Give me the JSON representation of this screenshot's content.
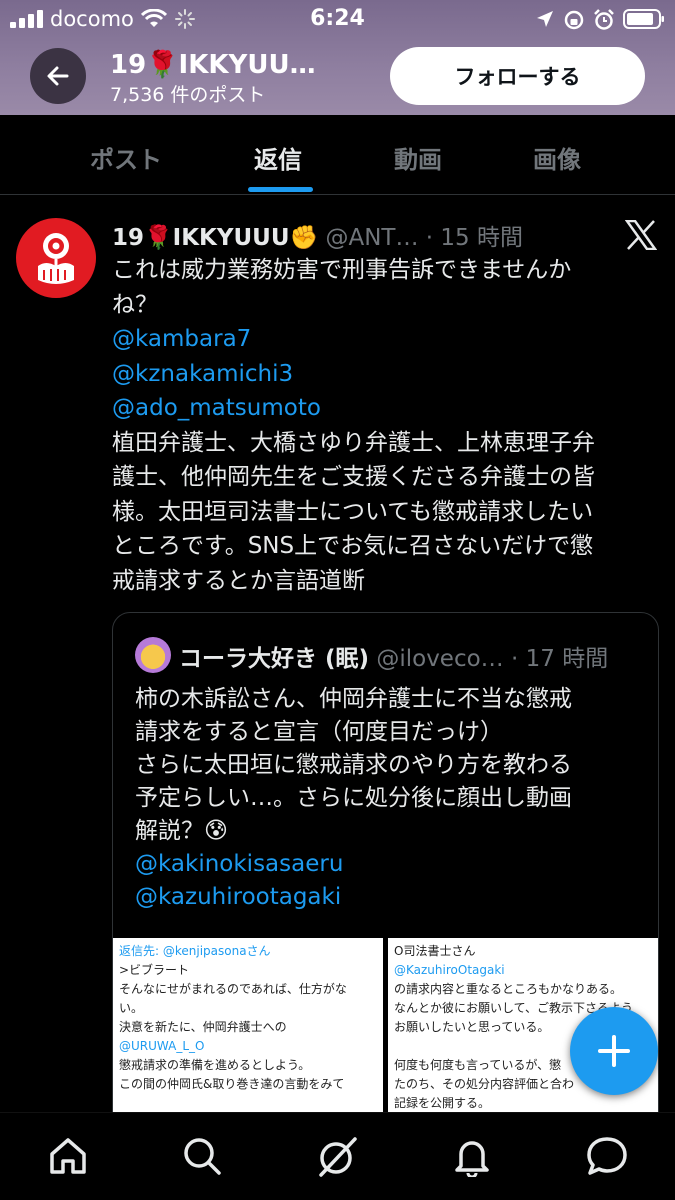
{
  "status_bar": {
    "carrier": "docomo",
    "time": "6:24"
  },
  "header": {
    "title": "19🌹IKKYUU…",
    "post_count": "7,536 件のポスト",
    "follow_label": "フォローする"
  },
  "tabs": [
    {
      "label": "ポスト",
      "active": false
    },
    {
      "label": "返信",
      "active": true
    },
    {
      "label": "動画",
      "active": false
    },
    {
      "label": "画像",
      "active": false
    }
  ],
  "tweet": {
    "display_name": "19🌹IKKYUUU✊",
    "handle": "@ANT…",
    "time": "· 15 時間",
    "text_lines": [
      "これは威力業務妨害で刑事告訴できませんか",
      "ね？"
    ],
    "mentions": [
      "@kambara7",
      "@kznakamichi3",
      "@ado_matsumoto"
    ],
    "body_lines": [
      "植田弁護士、大橋さゆり弁護士、上林恵理子弁",
      "護士、他仲岡先生をご支援くださる弁護士の皆",
      "様。太田垣司法書士についても懲戒請求したい",
      "ところです。SNS上でお気に召さないだけで懲",
      "戒請求するとか言語道断"
    ]
  },
  "quote": {
    "display_name": "コーラ大好き (眠)",
    "handle": "@iloveco…",
    "time": "· 17 時間",
    "lines": [
      "柿の木訴訟さん、仲岡弁護士に不当な懲戒",
      "請求をすると宣言（何度目だっけ）",
      "さらに太田垣に懲戒請求のやり方を教わる",
      "予定らしい…。さらに処分後に顔出し動画",
      "解説？😰"
    ],
    "mentions": [
      "@kakinokisasaeru",
      "@kazuhirootagaki"
    ],
    "image_left": {
      "reply_to": "返信先: @kenjipasonaさん",
      "lines": [
        ">ビブラート",
        "そんなにせがまれるのであれば、仕方がな",
        "い。",
        "決意を新たに、仲岡弁護士への",
        "@URUWA_L_O",
        "懲戒請求の準備を進めるとしよう。",
        "この間の仲岡氏&取り巻き達の言動をみて"
      ]
    },
    "image_right": {
      "lines": [
        "O司法書士さん",
        "@KazuhiroOtagaki",
        "の請求内容と重なるところもかなりある。",
        "なんとか彼にお願いして、ご教示下さるよう",
        "お願いしたいと思っている。",
        "",
        "何度も何度も言っているが、懲",
        "たのち、その処分内容評価と合わ",
        "記録を公開する。"
      ]
    }
  },
  "colors": {
    "accent": "#1d9bf0",
    "background": "#000000",
    "header_tint": "#8f7fa0"
  }
}
